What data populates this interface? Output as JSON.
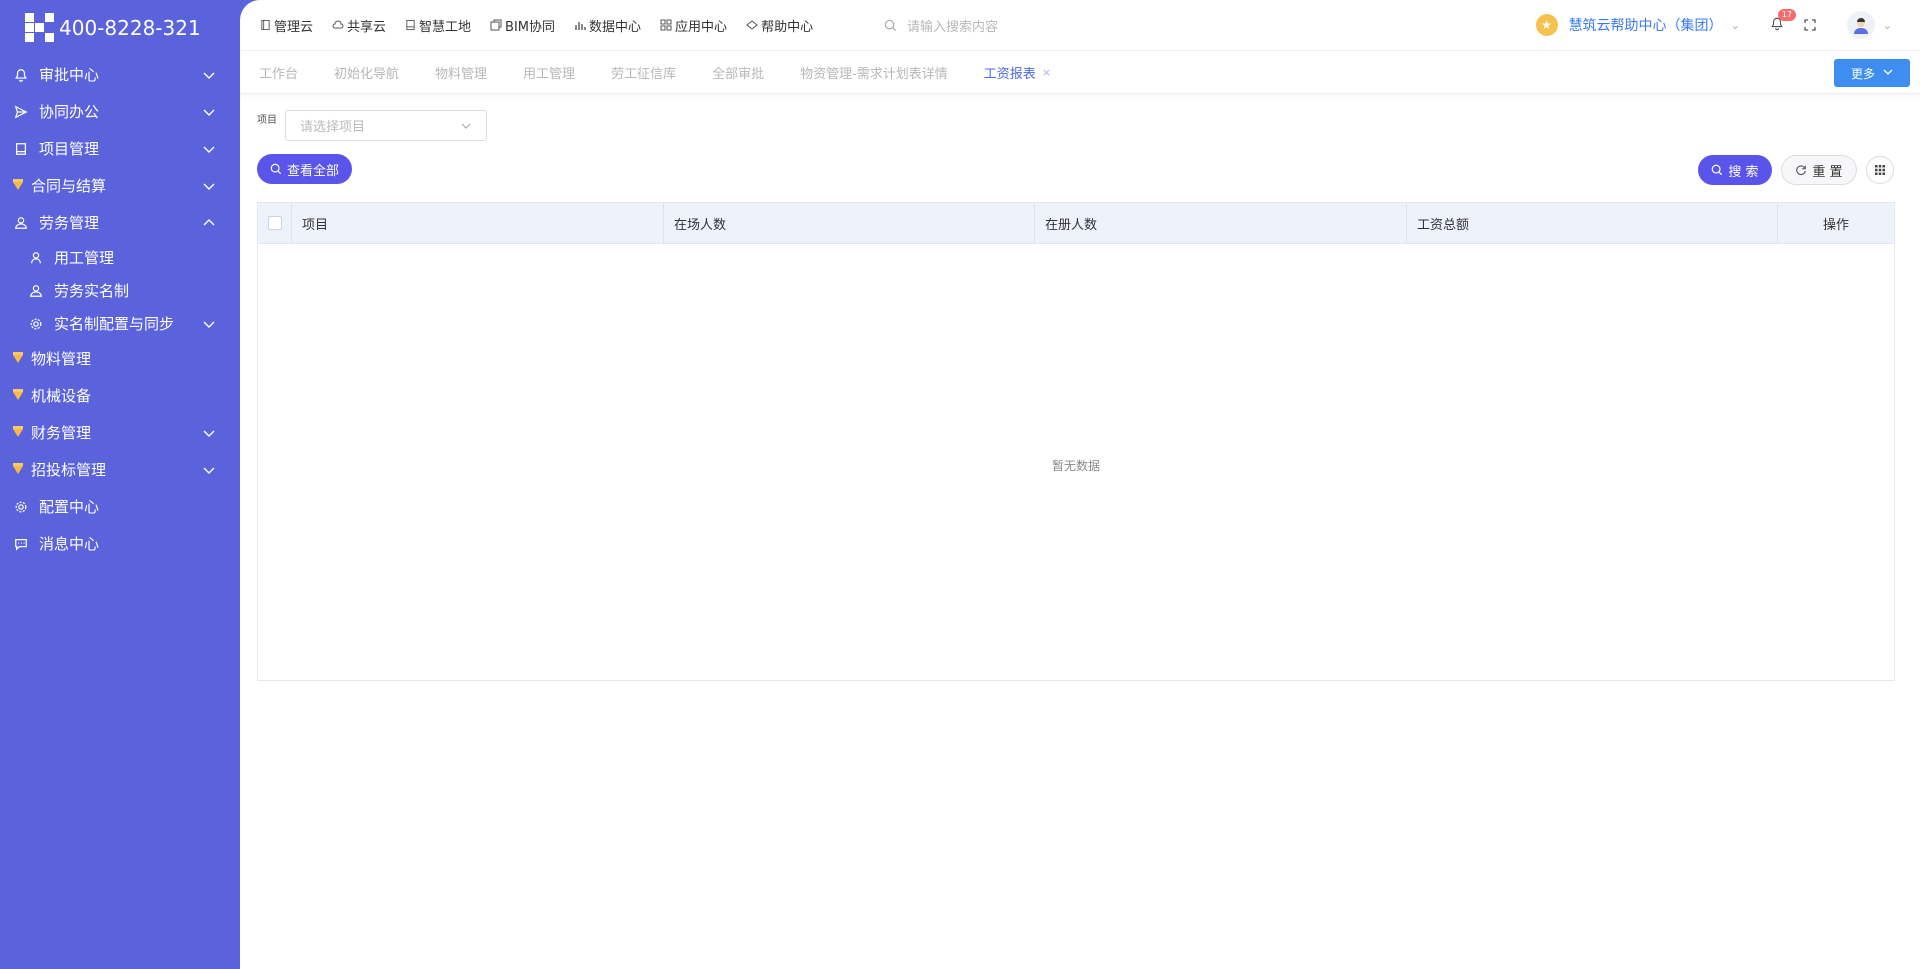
{
  "brand": {
    "phone": "400-8228-321"
  },
  "sidebar": {
    "items": [
      {
        "label": "审批中心",
        "icon": "bell-icon",
        "has_arrow": true,
        "arrow": "down"
      },
      {
        "label": "协同办公",
        "icon": "send-icon",
        "has_arrow": true,
        "arrow": "down"
      },
      {
        "label": "项目管理",
        "icon": "book-icon",
        "has_arrow": true,
        "arrow": "down"
      },
      {
        "label": "合同与结算",
        "icon": "gem-icon",
        "has_arrow": true,
        "arrow": "down"
      },
      {
        "label": "劳务管理",
        "icon": "worker-icon",
        "has_arrow": true,
        "arrow": "up",
        "expanded": true
      },
      {
        "label": "物料管理",
        "icon": "gem-icon",
        "has_arrow": false
      },
      {
        "label": "机械设备",
        "icon": "gem-icon",
        "has_arrow": false
      },
      {
        "label": "财务管理",
        "icon": "gem-icon",
        "has_arrow": true,
        "arrow": "down"
      },
      {
        "label": "招投标管理",
        "icon": "gem-icon",
        "has_arrow": true,
        "arrow": "down"
      },
      {
        "label": "配置中心",
        "icon": "gear-icon",
        "has_arrow": false
      },
      {
        "label": "消息中心",
        "icon": "message-icon",
        "has_arrow": false
      }
    ],
    "sub_items": [
      {
        "label": "用工管理",
        "icon": "person-icon"
      },
      {
        "label": "劳务实名制",
        "icon": "worker-icon"
      },
      {
        "label": "实名制配置与同步",
        "icon": "gear-icon",
        "has_arrow": true
      }
    ]
  },
  "topnav": {
    "items": [
      {
        "label": "管理云",
        "icon": "doc-icon"
      },
      {
        "label": "共享云",
        "icon": "cloud-icon"
      },
      {
        "label": "智慧工地",
        "icon": "book-icon"
      },
      {
        "label": "BIM协同",
        "icon": "bim-icon"
      },
      {
        "label": "数据中心",
        "icon": "bar-chart-icon"
      },
      {
        "label": "应用中心",
        "icon": "grid-icon"
      },
      {
        "label": "帮助中心",
        "icon": "help-icon"
      }
    ],
    "search_placeholder": "请输入搜索内容",
    "org_name": "慧筑云帮助中心（集团）",
    "notification_count": "17"
  },
  "tabs": {
    "items": [
      "工作台",
      "初始化导航",
      "物料管理",
      "用工管理",
      "劳工征信库",
      "全部审批",
      "物资管理-需求计划表详情",
      "工资报表"
    ],
    "active_index": 7,
    "close_mark": "×",
    "more_label": "更多"
  },
  "filter": {
    "project_label": "项目",
    "project_placeholder": "请选择项目"
  },
  "buttons": {
    "view_all": "查看全部",
    "search": "搜 索",
    "reset": "重 置"
  },
  "table": {
    "columns": [
      "项目",
      "在场人数",
      "在册人数",
      "工资总额",
      "操作"
    ],
    "rows": [],
    "empty_text": "暂无数据"
  },
  "colors": {
    "sidebar_bg": "#5b63dc",
    "primary_button": "#5a55ea",
    "more_button": "#3d8ef0",
    "active_tab": "#4b69e8",
    "org_link": "#3a7bf0",
    "badge": "#f56c6c"
  }
}
